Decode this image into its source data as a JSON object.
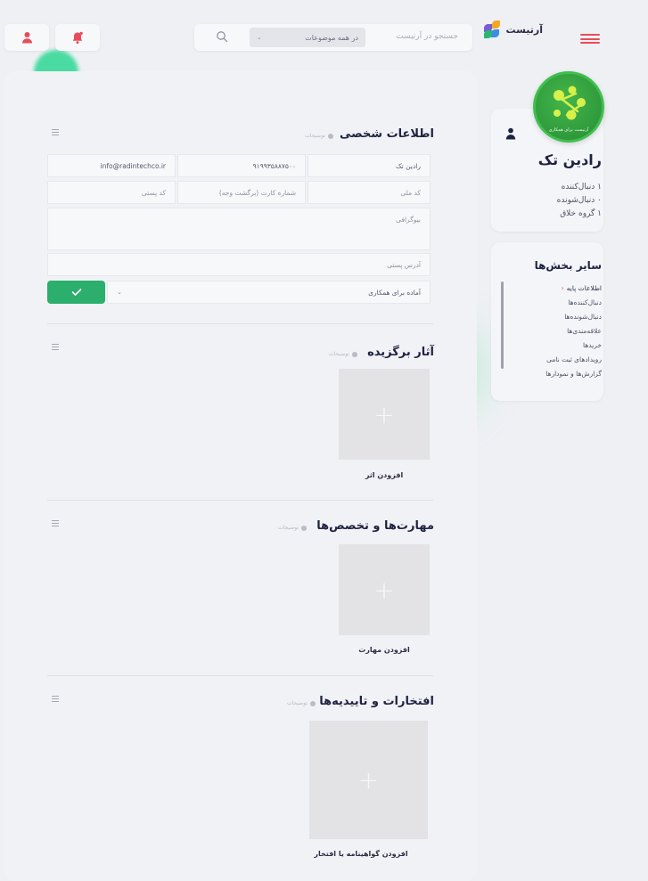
{
  "header": {
    "brand": "آرتیست",
    "search_placeholder": "جستجو در آرتیست",
    "category": "در همه موضوعات"
  },
  "personal": {
    "title": "اطلاعات شخصی",
    "note": "توضیحات",
    "name": "رادین تک",
    "phone": "۹۱۹۹۳۵۸۸۷۵۰۰",
    "email": "info@radintechco.ir",
    "national_code": "کد ملی",
    "card_number": "شماره کارت (برگشت وجه)",
    "postal_code": "کد پستی",
    "bio": "بیوگرافی",
    "address": "آدرس پستی",
    "cooperation": "آماده برای همکاری"
  },
  "works": {
    "title": "آثار برگزیده",
    "note": "توضیحات",
    "add_label": "افزودن اثر"
  },
  "skills": {
    "title": "مهارت‌ها و تخصص‌ها",
    "note": "توضیحات",
    "add_label": "افزودن مهارت"
  },
  "honors": {
    "title": "افتخارات و تاییدیه‌ها",
    "note": "توضیحات",
    "add_label": "افزودن گواهینامه یا افتخار"
  },
  "profile": {
    "name": "رادین تک",
    "followers": "۱ دنبال‌کننده",
    "following": "۰ دنبال‌شونده",
    "groups": "۱ گروه خلاق",
    "logo_caption": "آرتیست برای همکاری"
  },
  "sections": {
    "title": "سایر بخش‌ها",
    "items": [
      "اطلاعات پایه",
      "دنبال‌کننده‌ها",
      "دنبال‌شونده‌ها",
      "علاقه‌مندی‌ها",
      "خریدها",
      "رویدادهای ثبت نامی",
      "گزارش‌ها و نمودارها"
    ]
  },
  "colors": {
    "accent": "#e84c5b",
    "confirm": "#2cae6d",
    "logo_green": "#3fbf4d"
  },
  "icons": {
    "menu": "hamburger-menu-icon",
    "search": "search-icon",
    "bell": "bell-icon",
    "user": "user-icon",
    "check": "check-icon",
    "plus": "plus-icon",
    "grip": "grip-lines-icon"
  }
}
